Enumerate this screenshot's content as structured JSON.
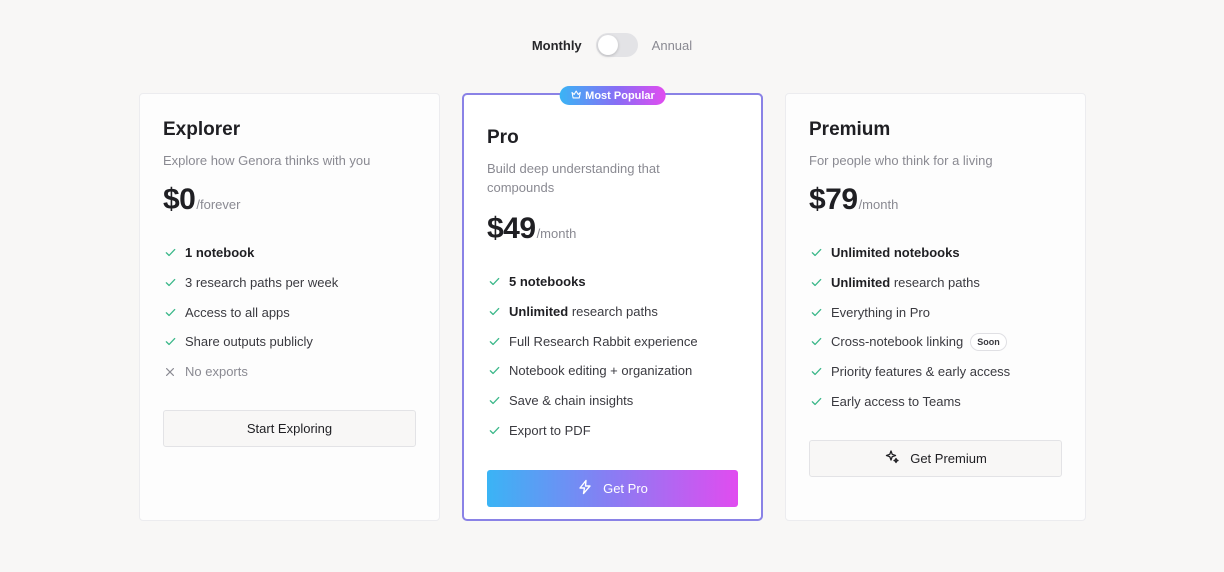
{
  "billing": {
    "monthly_label": "Monthly",
    "annual_label": "Annual",
    "annual_selected": false
  },
  "colors": {
    "accent_border": "#8a82e6",
    "gradient_start": "#3ab4f5",
    "gradient_end": "#e14cf0",
    "check": "#3cb88a"
  },
  "plans": {
    "explorer": {
      "title": "Explorer",
      "subtitle": "Explore how Genora thinks with you",
      "price": "$0",
      "period": "/forever",
      "features": [
        {
          "bold": "1 notebook",
          "text": "",
          "icon": "check-icon"
        },
        {
          "bold": "",
          "text": "3 research paths per week",
          "icon": "check-icon"
        },
        {
          "bold": "",
          "text": "Access to all apps",
          "icon": "check-icon"
        },
        {
          "bold": "",
          "text": "Share outputs publicly",
          "icon": "check-icon"
        },
        {
          "bold": "",
          "text": "No exports",
          "icon": "x-icon"
        }
      ],
      "button_label": "Start Exploring"
    },
    "pro": {
      "badge": "Most Popular",
      "badge_icon": "crown-icon",
      "title": "Pro",
      "subtitle": "Build deep understanding that compounds",
      "price": "$49",
      "period": "/month",
      "features": [
        {
          "bold": "5 notebooks",
          "text": "",
          "icon": "check-icon"
        },
        {
          "bold": "Unlimited",
          "text": " research paths",
          "icon": "check-icon"
        },
        {
          "bold": "",
          "text": "Full Research Rabbit experience",
          "icon": "check-icon"
        },
        {
          "bold": "",
          "text": "Notebook editing + organization",
          "icon": "check-icon"
        },
        {
          "bold": "",
          "text": "Save & chain insights",
          "icon": "check-icon"
        },
        {
          "bold": "",
          "text": "Export to PDF",
          "icon": "check-icon"
        }
      ],
      "button_label": "Get Pro",
      "button_icon": "lightning-icon"
    },
    "premium": {
      "title": "Premium",
      "subtitle": "For people who think for a living",
      "price": "$79",
      "period": "/month",
      "features": [
        {
          "bold": "Unlimited notebooks",
          "text": "",
          "icon": "check-icon"
        },
        {
          "bold": "Unlimited",
          "text": " research paths",
          "icon": "check-icon"
        },
        {
          "bold": "",
          "text": "Everything in Pro",
          "icon": "check-icon"
        },
        {
          "bold": "",
          "text": "Cross-notebook linking",
          "icon": "check-icon",
          "tag": "Soon"
        },
        {
          "bold": "",
          "text": "Priority features & early access",
          "icon": "check-icon"
        },
        {
          "bold": "",
          "text": "Early access to Teams",
          "icon": "check-icon"
        }
      ],
      "button_label": "Get Premium",
      "button_icon": "sparkles-icon"
    }
  }
}
